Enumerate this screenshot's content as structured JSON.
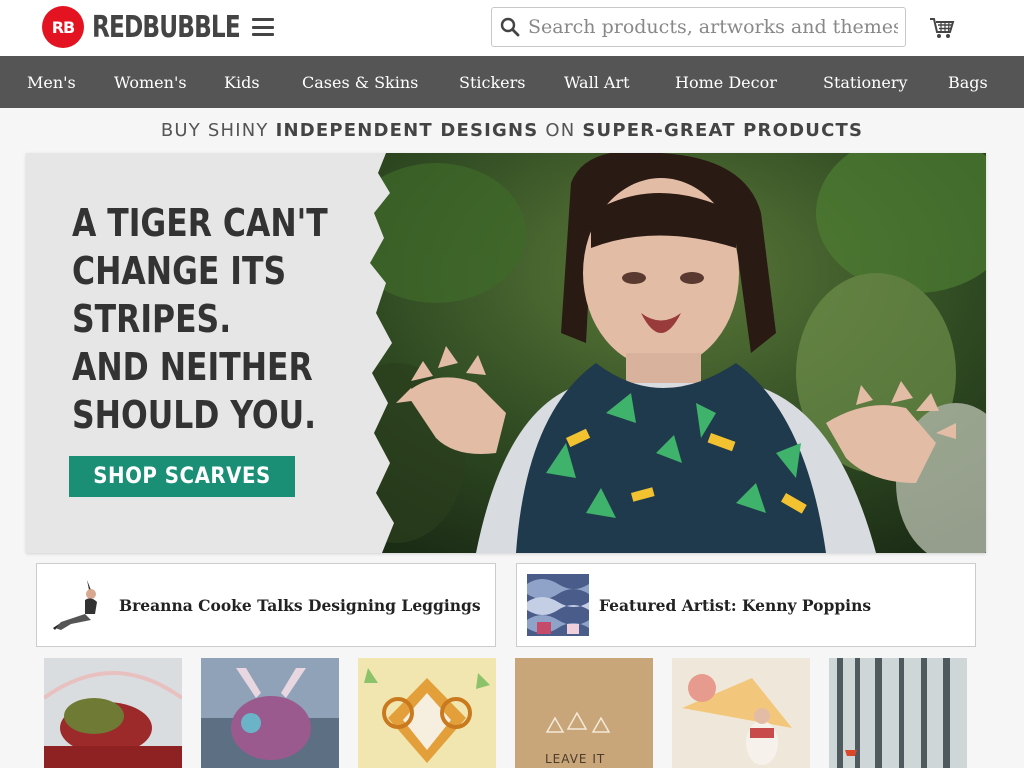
{
  "header": {
    "logo_mark": "RB",
    "logo_text": "REDBUBBLE",
    "search_placeholder": "Search products, artworks and themes"
  },
  "nav": {
    "items": [
      "Men's",
      "Women's",
      "Kids",
      "Cases & Skins",
      "Stickers",
      "Wall Art",
      "Home Decor",
      "Stationery",
      "Bags"
    ]
  },
  "tagline": {
    "part1": "BUY SHINY ",
    "part2": "INDEPENDENT DESIGNS",
    "part3": " ON ",
    "part4": "SUPER-GREAT PRODUCTS"
  },
  "hero": {
    "lines": [
      "A TIGER CAN'T",
      "CHANGE ITS",
      "STRIPES.",
      "AND NEITHER",
      "SHOULD YOU."
    ],
    "button_label": "SHOP SCARVES"
  },
  "features": [
    {
      "title": "Breanna Cooke Talks Designing Leggings"
    },
    {
      "title": "Featured Artist: Kenny Poppins"
    }
  ],
  "gallery": {
    "caption_4": "LEAVE IT"
  },
  "colors": {
    "brand": "#e41321",
    "nav_bg": "#555555",
    "cta": "#1a8f76"
  },
  "icons": [
    "redbubble-logo",
    "menu-icon",
    "search-icon",
    "cart-icon"
  ]
}
